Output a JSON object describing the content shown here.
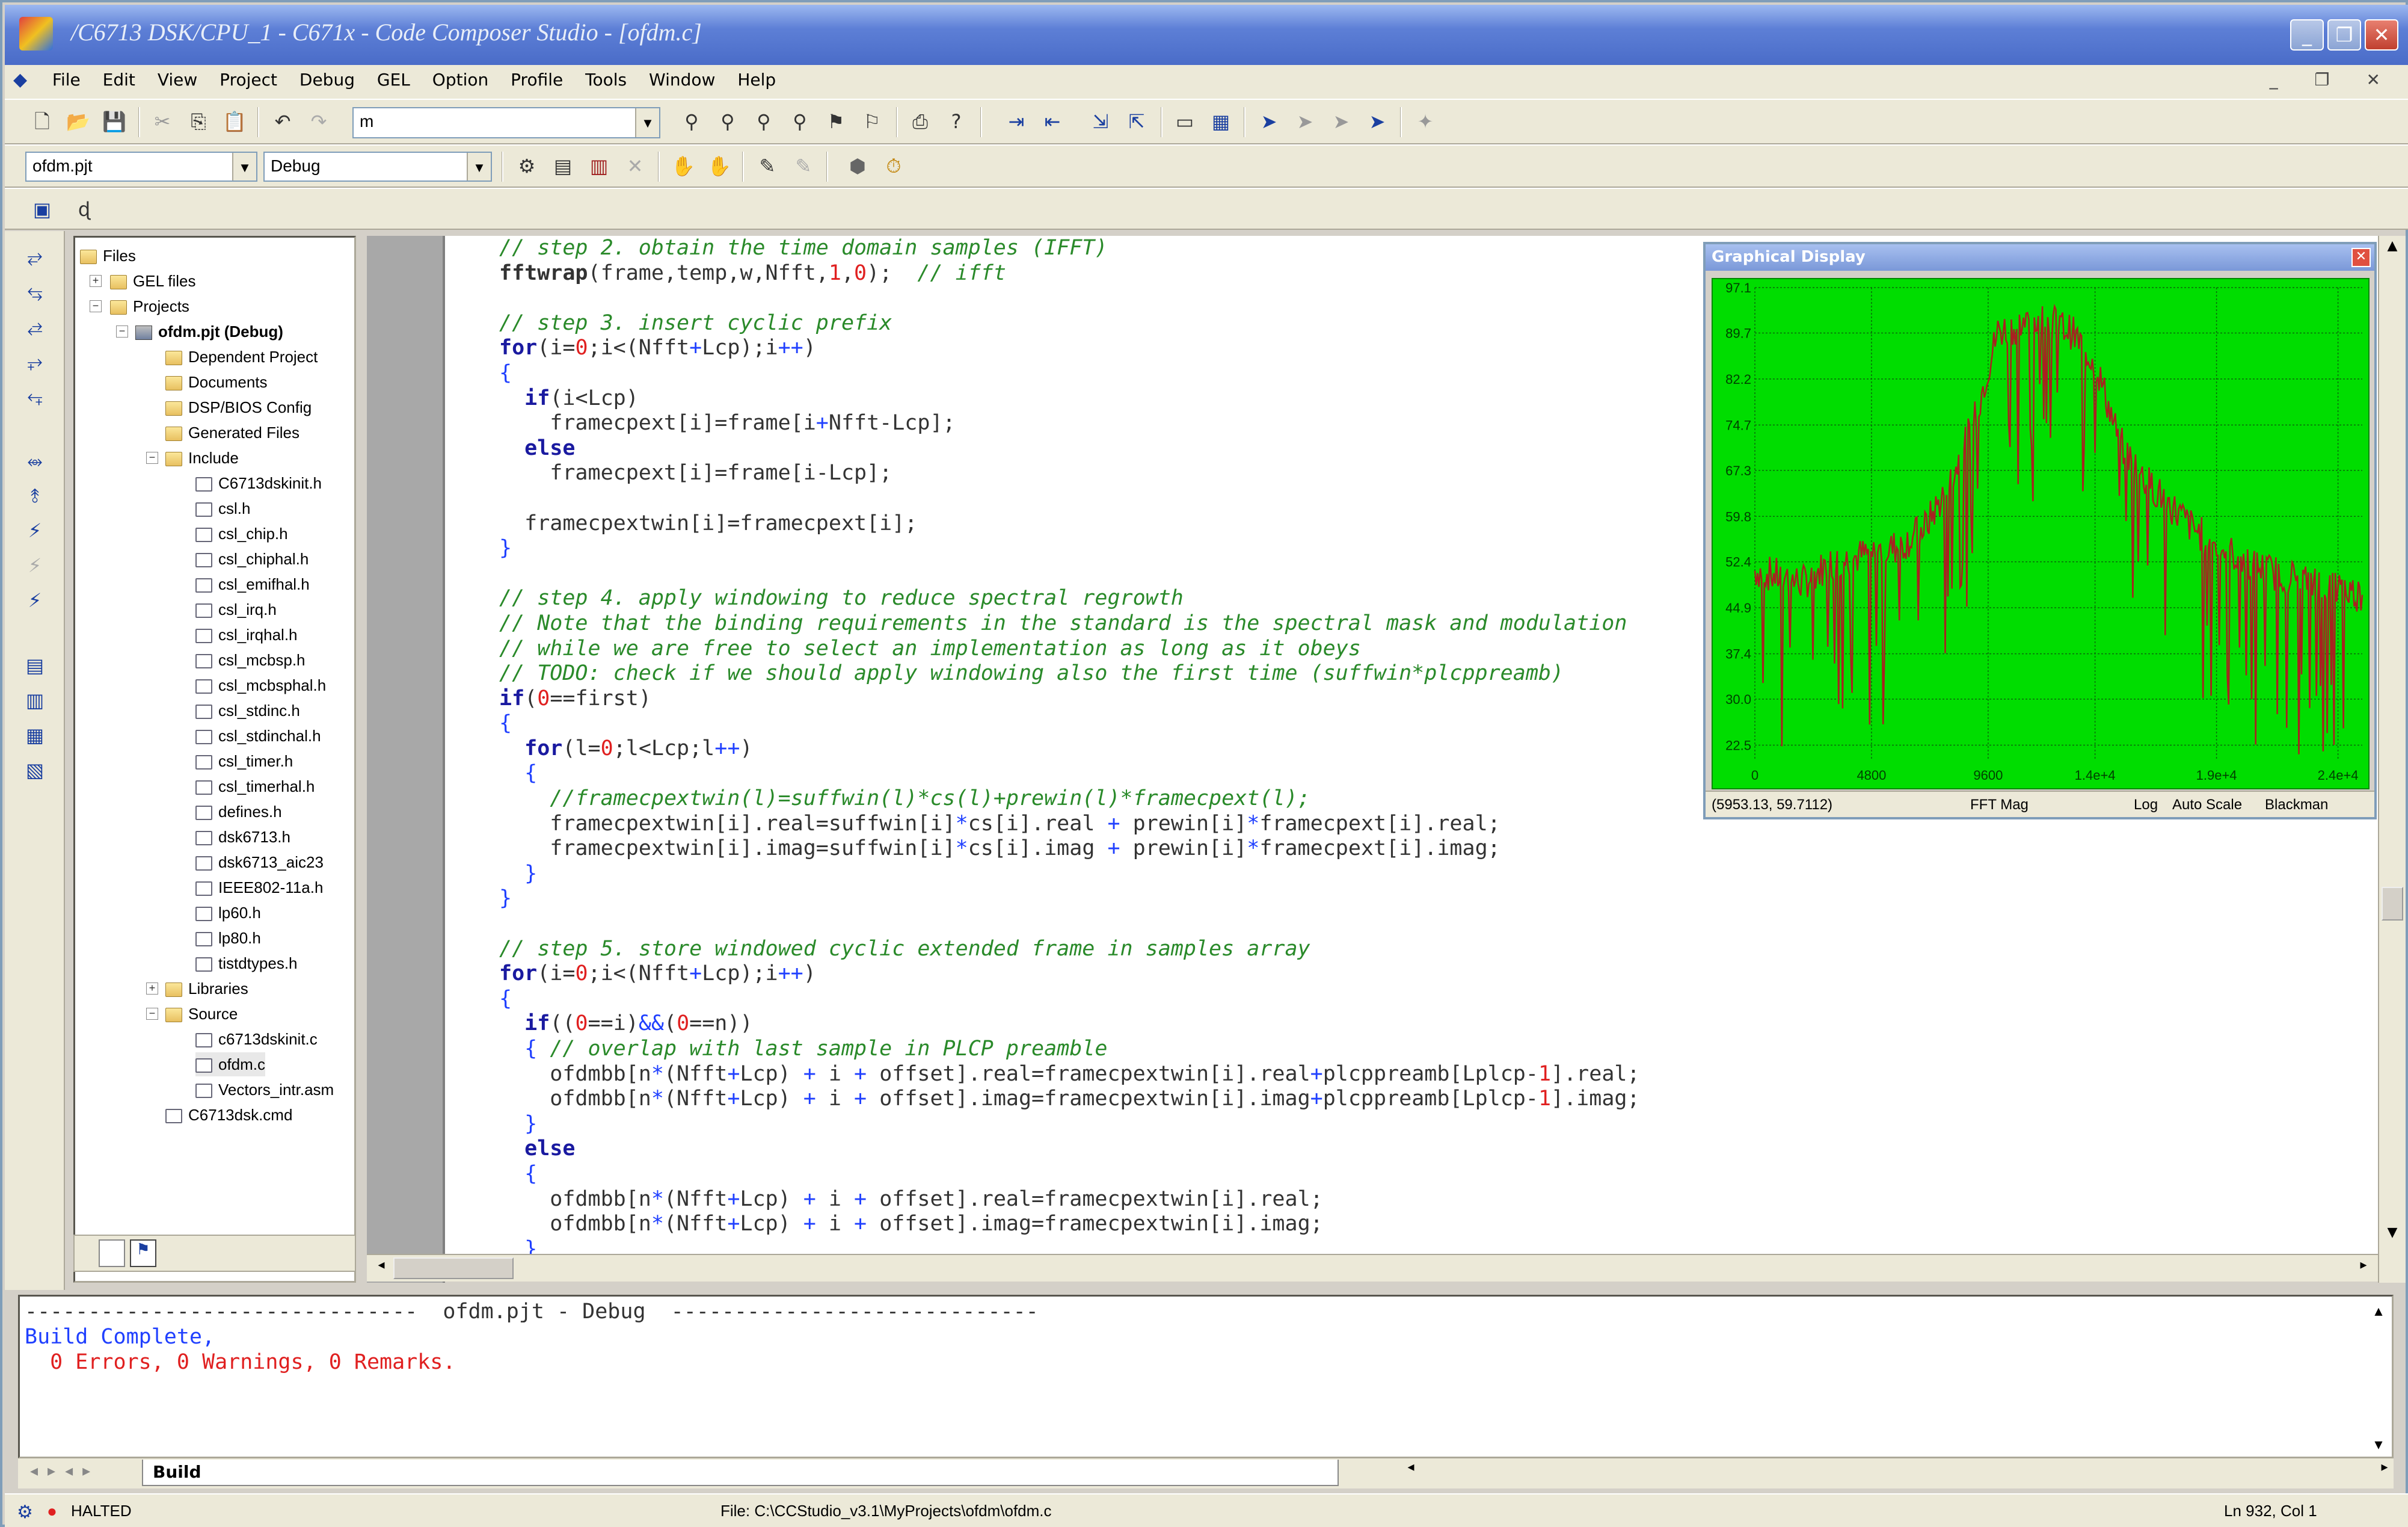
{
  "window": {
    "title": "/C6713 DSK/CPU_1 - C671x - Code Composer Studio - [ofdm.c]",
    "buttons": [
      "_",
      "❐",
      "✕"
    ]
  },
  "menu": {
    "items": [
      "File",
      "Edit",
      "View",
      "Project",
      "Debug",
      "GEL",
      "Option",
      "Profile",
      "Tools",
      "Window",
      "Help"
    ],
    "mdi_controls": "_ ❐ ✕"
  },
  "toolbar1": {
    "search_value": "m"
  },
  "toolbar2": {
    "project_select": "ofdm.pjt",
    "config_select": "Debug"
  },
  "tree": {
    "root": "Files",
    "gel": "GEL files",
    "projects": "Projects",
    "project": "ofdm.pjt (Debug)",
    "folders": [
      "Dependent Project",
      "Documents",
      "DSP/BIOS Config",
      "Generated Files",
      "Include"
    ],
    "include_files": [
      "C6713dskinit.h",
      "csl.h",
      "csl_chip.h",
      "csl_chiphal.h",
      "csl_emifhal.h",
      "csl_irq.h",
      "csl_irqhal.h",
      "csl_mcbsp.h",
      "csl_mcbsphal.h",
      "csl_stdinc.h",
      "csl_stdinchal.h",
      "csl_timer.h",
      "csl_timerhal.h",
      "defines.h",
      "dsk6713.h",
      "dsk6713_aic23",
      "IEEE802-11a.h",
      "lp60.h",
      "lp80.h",
      "tistdtypes.h"
    ],
    "libraries": "Libraries",
    "source": "Source",
    "source_files": [
      "c6713dskinit.c",
      "ofdm.c",
      "Vectors_intr.asm"
    ],
    "cmd": "C6713dsk.cmd"
  },
  "code_lines": [
    [
      [
        "cm",
        "// step 2. obtain the time domain samples (IFFT)"
      ]
    ],
    [
      [
        "b",
        "fftwrap"
      ],
      [
        "t",
        "(frame,temp,w,Nfft,"
      ],
      [
        "num",
        "1"
      ],
      [
        "t",
        ","
      ],
      [
        "num",
        "0"
      ],
      [
        "t",
        ");  "
      ],
      [
        "cm",
        "// ifft"
      ]
    ],
    [
      [
        "t",
        ""
      ]
    ],
    [
      [
        "cm",
        "// step 3. insert cyclic prefix"
      ]
    ],
    [
      [
        "kw",
        "for"
      ],
      [
        "t",
        "(i="
      ],
      [
        "num",
        "0"
      ],
      [
        "t",
        ";i<(Nfft"
      ],
      [
        "op",
        "+"
      ],
      [
        "t",
        "Lcp);i"
      ],
      [
        "op",
        "++"
      ],
      [
        "t",
        ")"
      ]
    ],
    [
      [
        "op",
        "{"
      ]
    ],
    [
      [
        "t",
        "  "
      ],
      [
        "kw",
        "if"
      ],
      [
        "t",
        "(i<Lcp)"
      ]
    ],
    [
      [
        "t",
        "    framecpext[i]=frame[i"
      ],
      [
        "op",
        "+"
      ],
      [
        "t",
        "Nfft-Lcp];"
      ]
    ],
    [
      [
        "t",
        "  "
      ],
      [
        "kw",
        "else"
      ]
    ],
    [
      [
        "t",
        "    framecpext[i]=frame[i-Lcp];"
      ]
    ],
    [
      [
        "t",
        ""
      ]
    ],
    [
      [
        "t",
        "  framecpextwin[i]=framecpext[i];"
      ]
    ],
    [
      [
        "op",
        "}"
      ]
    ],
    [
      [
        "t",
        ""
      ]
    ],
    [
      [
        "cm",
        "// step 4. apply windowing to reduce spectral regrowth"
      ]
    ],
    [
      [
        "cm",
        "// Note that the binding requirements in the standard is the spectral mask and modulation"
      ]
    ],
    [
      [
        "cm",
        "// while we are free to select an implementation as long as it obeys"
      ]
    ],
    [
      [
        "cm",
        "// TODO: check if we should apply windowing also the first time (suffwin*plcppreamb)"
      ]
    ],
    [
      [
        "kw",
        "if"
      ],
      [
        "t",
        "("
      ],
      [
        "num",
        "0"
      ],
      [
        "t",
        "==first)"
      ]
    ],
    [
      [
        "op",
        "{"
      ]
    ],
    [
      [
        "t",
        "  "
      ],
      [
        "kw",
        "for"
      ],
      [
        "t",
        "(l="
      ],
      [
        "num",
        "0"
      ],
      [
        "t",
        ";l<Lcp;l"
      ],
      [
        "op",
        "++"
      ],
      [
        "t",
        ")"
      ]
    ],
    [
      [
        "t",
        "  "
      ],
      [
        "op",
        "{"
      ]
    ],
    [
      [
        "t",
        "    "
      ],
      [
        "cm",
        "//framecpextwin(l)=suffwin(l)*cs(l)+prewin(l)*framecpext(l);"
      ]
    ],
    [
      [
        "t",
        "    framecpextwin[i].real=suffwin[i]"
      ],
      [
        "op",
        "*"
      ],
      [
        "t",
        "cs[i].real "
      ],
      [
        "op",
        "+"
      ],
      [
        "t",
        " prewin[i]"
      ],
      [
        "op",
        "*"
      ],
      [
        "t",
        "framecpext[i].real;"
      ]
    ],
    [
      [
        "t",
        "    framecpextwin[i].imag=suffwin[i]"
      ],
      [
        "op",
        "*"
      ],
      [
        "t",
        "cs[i].imag "
      ],
      [
        "op",
        "+"
      ],
      [
        "t",
        " prewin[i]"
      ],
      [
        "op",
        "*"
      ],
      [
        "t",
        "framecpext[i].imag;"
      ]
    ],
    [
      [
        "t",
        "  "
      ],
      [
        "op",
        "}"
      ]
    ],
    [
      [
        "op",
        "}"
      ]
    ],
    [
      [
        "t",
        ""
      ]
    ],
    [
      [
        "cm",
        "// step 5. store windowed cyclic extended frame in samples array"
      ]
    ],
    [
      [
        "kw",
        "for"
      ],
      [
        "t",
        "(i="
      ],
      [
        "num",
        "0"
      ],
      [
        "t",
        ";i<(Nfft"
      ],
      [
        "op",
        "+"
      ],
      [
        "t",
        "Lcp);i"
      ],
      [
        "op",
        "++"
      ],
      [
        "t",
        ")"
      ]
    ],
    [
      [
        "op",
        "{"
      ]
    ],
    [
      [
        "t",
        "  "
      ],
      [
        "kw",
        "if"
      ],
      [
        "t",
        "(("
      ],
      [
        "num",
        "0"
      ],
      [
        "t",
        "==i)"
      ],
      [
        "op",
        "&&"
      ],
      [
        "t",
        "("
      ],
      [
        "num",
        "0"
      ],
      [
        "t",
        "==n))"
      ]
    ],
    [
      [
        "t",
        "  "
      ],
      [
        "op",
        "{"
      ],
      [
        "t",
        " "
      ],
      [
        "cm",
        "// overlap with last sample in PLCP preamble"
      ]
    ],
    [
      [
        "t",
        "    ofdmbb[n"
      ],
      [
        "op",
        "*"
      ],
      [
        "t",
        "(Nfft"
      ],
      [
        "op",
        "+"
      ],
      [
        "t",
        "Lcp) "
      ],
      [
        "op",
        "+"
      ],
      [
        "t",
        " i "
      ],
      [
        "op",
        "+"
      ],
      [
        "t",
        " offset].real=framecpextwin[i].real"
      ],
      [
        "op",
        "+"
      ],
      [
        "t",
        "plcppreamb[Lplcp-"
      ],
      [
        "num",
        "1"
      ],
      [
        "t",
        "].real;"
      ]
    ],
    [
      [
        "t",
        "    ofdmbb[n"
      ],
      [
        "op",
        "*"
      ],
      [
        "t",
        "(Nfft"
      ],
      [
        "op",
        "+"
      ],
      [
        "t",
        "Lcp) "
      ],
      [
        "op",
        "+"
      ],
      [
        "t",
        " i "
      ],
      [
        "op",
        "+"
      ],
      [
        "t",
        " offset].imag=framecpextwin[i].imag"
      ],
      [
        "op",
        "+"
      ],
      [
        "t",
        "plcppreamb[Lplcp-"
      ],
      [
        "num",
        "1"
      ],
      [
        "t",
        "].imag;"
      ]
    ],
    [
      [
        "t",
        "  "
      ],
      [
        "op",
        "}"
      ]
    ],
    [
      [
        "t",
        "  "
      ],
      [
        "kw",
        "else"
      ]
    ],
    [
      [
        "t",
        "  "
      ],
      [
        "op",
        "{"
      ]
    ],
    [
      [
        "t",
        "    ofdmbb[n"
      ],
      [
        "op",
        "*"
      ],
      [
        "t",
        "(Nfft"
      ],
      [
        "op",
        "+"
      ],
      [
        "t",
        "Lcp) "
      ],
      [
        "op",
        "+"
      ],
      [
        "t",
        " i "
      ],
      [
        "op",
        "+"
      ],
      [
        "t",
        " offset].real=framecpextwin[i].real;"
      ]
    ],
    [
      [
        "t",
        "    ofdmbb[n"
      ],
      [
        "op",
        "*"
      ],
      [
        "t",
        "(Nfft"
      ],
      [
        "op",
        "+"
      ],
      [
        "t",
        "Lcp) "
      ],
      [
        "op",
        "+"
      ],
      [
        "t",
        " i "
      ],
      [
        "op",
        "+"
      ],
      [
        "t",
        " offset].imag=framecpextwin[i].imag;"
      ]
    ],
    [
      [
        "t",
        "  "
      ],
      [
        "op",
        "}"
      ]
    ]
  ],
  "graph": {
    "title": "Graphical Display",
    "status_coords": "(5953.13, 59.7112)",
    "status_mode": "FFT Mag",
    "status_scale": "Log",
    "status_auto": "Auto Scale",
    "status_window": "Blackman",
    "colors": {
      "background": "#00dd00",
      "trace": "#aa2020",
      "grid": "#0a6a0a"
    }
  },
  "chart_data": {
    "type": "line",
    "title": "",
    "xlabel": "",
    "ylabel": "",
    "xlim": [
      0,
      25000
    ],
    "ylim": [
      20,
      97.1
    ],
    "x_ticks": [
      "0",
      "4800",
      "9600",
      "1.4e+4",
      "1.9e+4",
      "2.4e+4"
    ],
    "x_tick_values": [
      0,
      4800,
      9600,
      14000,
      19000,
      24000
    ],
    "y_ticks": [
      "97.1",
      "89.7",
      "82.2",
      "74.7",
      "67.3",
      "59.8",
      "52.4",
      "44.9",
      "37.4",
      "30.0",
      "22.5"
    ],
    "y_tick_values": [
      97.1,
      89.7,
      82.2,
      74.7,
      67.3,
      59.8,
      52.4,
      44.9,
      37.4,
      30.0,
      22.5
    ],
    "series": [
      {
        "x": [
          0,
          1000,
          2000,
          3000,
          4000,
          5000,
          6000,
          7000,
          8000,
          9000,
          10000,
          11000,
          12000,
          13000,
          14000,
          15000,
          16000,
          17000,
          18000,
          19000,
          20000,
          21000,
          22000,
          23000,
          24000,
          25000
        ],
        "values": [
          51,
          50,
          49,
          52,
          53,
          54,
          55,
          58,
          65,
          75,
          90,
          91,
          92,
          90,
          85,
          72,
          66,
          62,
          58,
          55,
          53,
          51,
          50,
          49,
          48,
          47
        ]
      }
    ],
    "grid": true
  },
  "output": {
    "header": "-------------------------------  ofdm.pjt - Debug  -----------------------------",
    "build": "Build Complete,",
    "errors": "  0 Errors, 0 Warnings, 0 Remarks.",
    "tab": "Build"
  },
  "status": {
    "state": "HALTED",
    "file": "File: C:\\CCStudio_v3.1\\MyProjects\\ofdm\\ofdm.c",
    "position": "Ln 932, Col 1"
  }
}
